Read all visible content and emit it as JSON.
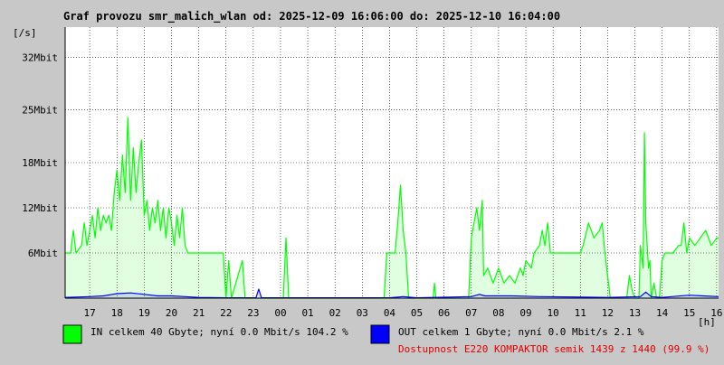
{
  "chart_data": {
    "type": "area",
    "title": "Graf provozu smr_malich_wlan od: 2025-12-09 16:06:00 do: 2025-12-10 16:04:00",
    "ylabel": "[/s]",
    "xlabel": "[h]",
    "ylim_mbit": [
      0,
      36
    ],
    "y_ticks": [
      {
        "value": 6,
        "label": "6Mbit"
      },
      {
        "value": 12,
        "label": "12Mbit"
      },
      {
        "value": 18,
        "label": "18Mbit"
      },
      {
        "value": 25,
        "label": "25Mbit"
      },
      {
        "value": 32,
        "label": "32Mbit"
      }
    ],
    "x_range_hours": [
      16.1,
      40.07
    ],
    "x_ticks": [
      {
        "value": 17,
        "label": "17"
      },
      {
        "value": 18,
        "label": "18"
      },
      {
        "value": 19,
        "label": "19"
      },
      {
        "value": 20,
        "label": "20"
      },
      {
        "value": 21,
        "label": "21"
      },
      {
        "value": 22,
        "label": "22"
      },
      {
        "value": 23,
        "label": "23"
      },
      {
        "value": 24,
        "label": "00"
      },
      {
        "value": 25,
        "label": "01"
      },
      {
        "value": 26,
        "label": "02"
      },
      {
        "value": 27,
        "label": "03"
      },
      {
        "value": 28,
        "label": "04"
      },
      {
        "value": 29,
        "label": "05"
      },
      {
        "value": 30,
        "label": "06"
      },
      {
        "value": 31,
        "label": "07"
      },
      {
        "value": 32,
        "label": "08"
      },
      {
        "value": 33,
        "label": "09"
      },
      {
        "value": 34,
        "label": "10"
      },
      {
        "value": 35,
        "label": "11"
      },
      {
        "value": 36,
        "label": "12"
      },
      {
        "value": 37,
        "label": "13"
      },
      {
        "value": 38,
        "label": "14"
      },
      {
        "value": 39,
        "label": "15"
      },
      {
        "value": 40,
        "label": "16"
      }
    ],
    "grid": true,
    "series": [
      {
        "name": "IN",
        "color": "#00ff00",
        "points": [
          [
            16.1,
            6
          ],
          [
            16.3,
            6
          ],
          [
            16.4,
            9
          ],
          [
            16.5,
            6
          ],
          [
            16.7,
            7
          ],
          [
            16.8,
            10
          ],
          [
            16.9,
            7
          ],
          [
            17.0,
            9
          ],
          [
            17.1,
            11
          ],
          [
            17.2,
            8
          ],
          [
            17.3,
            12
          ],
          [
            17.4,
            9
          ],
          [
            17.5,
            11
          ],
          [
            17.6,
            10
          ],
          [
            17.7,
            11
          ],
          [
            17.8,
            9
          ],
          [
            17.9,
            14
          ],
          [
            18.0,
            17
          ],
          [
            18.1,
            13
          ],
          [
            18.2,
            19
          ],
          [
            18.3,
            14
          ],
          [
            18.4,
            24
          ],
          [
            18.5,
            13
          ],
          [
            18.6,
            20
          ],
          [
            18.7,
            14
          ],
          [
            18.8,
            18
          ],
          [
            18.9,
            21
          ],
          [
            19.0,
            11
          ],
          [
            19.1,
            13
          ],
          [
            19.2,
            9
          ],
          [
            19.3,
            12
          ],
          [
            19.4,
            10
          ],
          [
            19.5,
            13
          ],
          [
            19.6,
            9
          ],
          [
            19.7,
            12
          ],
          [
            19.8,
            8
          ],
          [
            19.9,
            12
          ],
          [
            20.0,
            10
          ],
          [
            20.1,
            7
          ],
          [
            20.2,
            11
          ],
          [
            20.3,
            8
          ],
          [
            20.4,
            12
          ],
          [
            20.5,
            7
          ],
          [
            20.6,
            6
          ],
          [
            20.9,
            6
          ],
          [
            21.0,
            6
          ],
          [
            21.4,
            6
          ],
          [
            21.5,
            6
          ],
          [
            21.9,
            6
          ],
          [
            22.0,
            0
          ],
          [
            22.1,
            5
          ],
          [
            22.2,
            0
          ],
          [
            22.6,
            5
          ],
          [
            22.7,
            0
          ],
          [
            24.1,
            0
          ],
          [
            24.2,
            8
          ],
          [
            24.3,
            0
          ],
          [
            27.8,
            0
          ],
          [
            27.9,
            6
          ],
          [
            28.0,
            6
          ],
          [
            28.2,
            6
          ],
          [
            28.3,
            10
          ],
          [
            28.4,
            15
          ],
          [
            28.5,
            9
          ],
          [
            28.6,
            6
          ],
          [
            28.7,
            0
          ],
          [
            29.6,
            0
          ],
          [
            29.65,
            2
          ],
          [
            29.7,
            0
          ],
          [
            30.9,
            0
          ],
          [
            31.0,
            8
          ],
          [
            31.1,
            10
          ],
          [
            31.2,
            12
          ],
          [
            31.3,
            9
          ],
          [
            31.4,
            13
          ],
          [
            31.45,
            3
          ],
          [
            31.6,
            4
          ],
          [
            31.8,
            2
          ],
          [
            32.0,
            4
          ],
          [
            32.2,
            2
          ],
          [
            32.4,
            3
          ],
          [
            32.6,
            2
          ],
          [
            32.8,
            4
          ],
          [
            32.9,
            3
          ],
          [
            33.0,
            5
          ],
          [
            33.2,
            4
          ],
          [
            33.3,
            6
          ],
          [
            33.5,
            7
          ],
          [
            33.6,
            9
          ],
          [
            33.7,
            7
          ],
          [
            33.8,
            10
          ],
          [
            33.9,
            6
          ],
          [
            34.0,
            6
          ],
          [
            34.5,
            6
          ],
          [
            34.8,
            6
          ],
          [
            35.0,
            6
          ],
          [
            35.1,
            7
          ],
          [
            35.3,
            10
          ],
          [
            35.5,
            8
          ],
          [
            35.7,
            9
          ],
          [
            35.8,
            10
          ],
          [
            35.9,
            6
          ],
          [
            36.1,
            0
          ],
          [
            36.7,
            0
          ],
          [
            36.8,
            3
          ],
          [
            36.9,
            1
          ],
          [
            37.0,
            0
          ],
          [
            37.15,
            0
          ],
          [
            37.2,
            7
          ],
          [
            37.3,
            4
          ],
          [
            37.35,
            22
          ],
          [
            37.4,
            10
          ],
          [
            37.5,
            4
          ],
          [
            37.55,
            5
          ],
          [
            37.6,
            0
          ],
          [
            37.7,
            2
          ],
          [
            37.8,
            0
          ],
          [
            37.9,
            0
          ],
          [
            38.0,
            5
          ],
          [
            38.1,
            6
          ],
          [
            38.2,
            6
          ],
          [
            38.4,
            6
          ],
          [
            38.6,
            7
          ],
          [
            38.7,
            7
          ],
          [
            38.8,
            10
          ],
          [
            38.9,
            6
          ],
          [
            39.0,
            8
          ],
          [
            39.2,
            7
          ],
          [
            39.4,
            8
          ],
          [
            39.6,
            9
          ],
          [
            39.8,
            7
          ],
          [
            40.0,
            8
          ],
          [
            40.07,
            8
          ]
        ]
      },
      {
        "name": "OUT",
        "color": "#0000ff",
        "points": [
          [
            16.1,
            0.1
          ],
          [
            17.0,
            0.2
          ],
          [
            17.5,
            0.3
          ],
          [
            18.0,
            0.6
          ],
          [
            18.5,
            0.7
          ],
          [
            19.0,
            0.5
          ],
          [
            19.5,
            0.3
          ],
          [
            20.0,
            0.3
          ],
          [
            20.5,
            0.2
          ],
          [
            21.0,
            0.1
          ],
          [
            22.0,
            0.05
          ],
          [
            23.1,
            0.05
          ],
          [
            23.2,
            1.2
          ],
          [
            23.3,
            0.05
          ],
          [
            28.0,
            0.05
          ],
          [
            28.5,
            0.2
          ],
          [
            29.0,
            0.05
          ],
          [
            31.0,
            0.2
          ],
          [
            31.3,
            0.5
          ],
          [
            31.5,
            0.3
          ],
          [
            32.5,
            0.3
          ],
          [
            33.5,
            0.2
          ],
          [
            36.0,
            0.1
          ],
          [
            37.2,
            0.2
          ],
          [
            37.4,
            0.8
          ],
          [
            37.6,
            0.2
          ],
          [
            38.0,
            0.1
          ],
          [
            39.0,
            0.4
          ],
          [
            39.5,
            0.3
          ],
          [
            40.07,
            0.2
          ]
        ]
      }
    ]
  },
  "legend": {
    "in": {
      "color": "#00ff00",
      "text": "IN celkem 40 Gbyte; nyní   0.0 Mbit/s 104.2 %"
    },
    "out": {
      "color": "#0000ff",
      "text": "OUT celkem 1 Gbyte; nyní   0.0 Mbit/s 2.1 %"
    },
    "availability": "Dostupnost E220 KOMPAKTOR semik 1439 z 1440 (99.9 %)"
  }
}
